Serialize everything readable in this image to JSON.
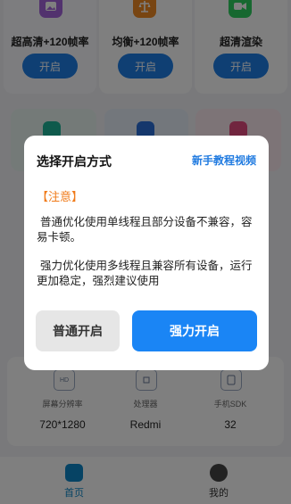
{
  "modes": [
    {
      "label": "超高清+120帧率",
      "button": "开启",
      "icon": "image-icon",
      "color": "#9b59d6"
    },
    {
      "label": "均衡+120帧率",
      "button": "开启",
      "icon": "balance-icon",
      "color": "#f08a24"
    },
    {
      "label": "超清渲染",
      "button": "开启",
      "icon": "video-camera-icon",
      "color": "#2ecc5e"
    }
  ],
  "device_info": [
    {
      "label": "屏幕分辨率",
      "value": "720*1280",
      "icon": "hd-icon"
    },
    {
      "label": "处理器",
      "value": "Redmi",
      "icon": "chip-icon"
    },
    {
      "label": "手机SDK",
      "value": "32",
      "icon": "phone-icon"
    }
  ],
  "tabs": [
    {
      "label": "首页",
      "active": true
    },
    {
      "label": "我的",
      "active": false
    }
  ],
  "dialog": {
    "title": "选择开启方式",
    "tutorial_link": "新手教程视频",
    "notice": "【注意】",
    "para_normal": "普通优化使用单线程且部分设备不兼容，容易卡顿。",
    "para_strong": "强力优化使用多线程且兼容所有设备，运行更加稳定，强烈建议使用",
    "btn_normal": "普通开启",
    "btn_strong": "强力开启"
  },
  "colors": {
    "accent": "#1a85f5",
    "notice": "#f07b1a",
    "link": "#1f7ae0"
  }
}
